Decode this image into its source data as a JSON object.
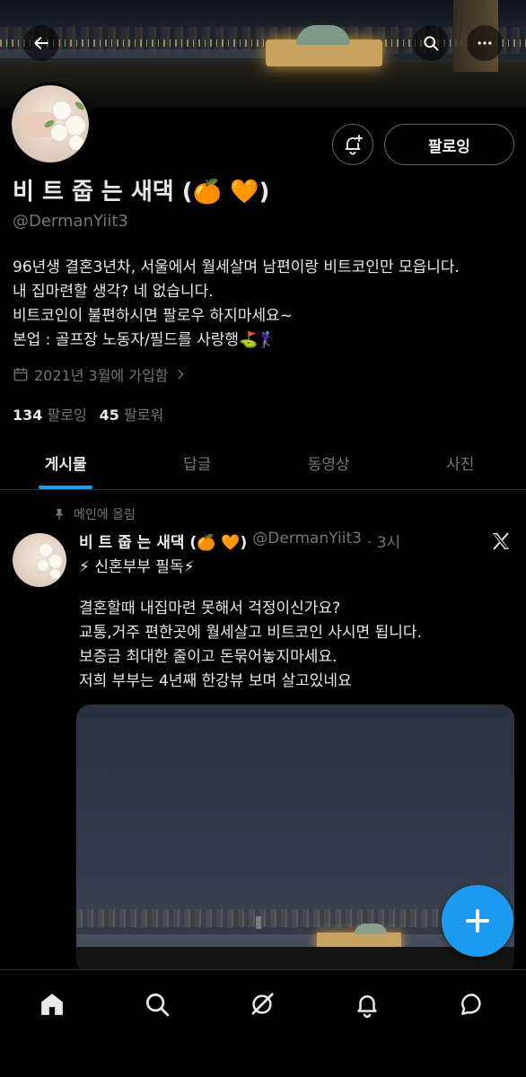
{
  "header": {
    "back_icon": "arrow-left-icon",
    "search_icon": "search-icon",
    "more_icon": "more-horizontal-icon"
  },
  "profile": {
    "display_name": "비 트 줍 는 새댁 (🍊 🧡)",
    "handle": "@DermanYiit3",
    "follow_label": "팔로잉",
    "notify_icon": "bell-plus-icon",
    "bio": [
      "96년생 결혼3년차, 서울에서 월세살며 남편이랑 비트코인만 모읍니다.",
      "내 집마련할 생각? 네 없습니다.",
      "비트코인이 불편하시면 팔로우 하지마세요~",
      "본업 : 골프장 노동자/필드를 사랑행⛳️🏌️‍♀️"
    ],
    "joined": "2021년 3월에 가입함",
    "following_count": "134",
    "following_label": "팔로잉",
    "followers_count": "45",
    "followers_label": "팔로워"
  },
  "tabs": [
    {
      "label": "게시물",
      "active": true
    },
    {
      "label": "답글",
      "active": false
    },
    {
      "label": "동영상",
      "active": false
    },
    {
      "label": "사진",
      "active": false
    }
  ],
  "post": {
    "pinned_label": "메인에 올림",
    "author_name": "비 트 줍 는 새댁 (🍊 🧡)",
    "author_handle": "@DermanYiit3",
    "time": "· 3시",
    "tagline": "⚡ 신혼부부 필독⚡",
    "body": [
      "결혼할때 내집마련 못해서 걱정이신가요?",
      "교통,거주 편한곳에 월세살고 비트코인 사시면 됩니다.",
      "보증금 최대한 줄이고 돈묶어놓지마세요.",
      "저희 부부는 4년째 한강뷰 보며 살고있네요"
    ]
  },
  "fab": {
    "icon": "plus-icon"
  },
  "bottom_nav": [
    {
      "icon": "home-icon",
      "active": true
    },
    {
      "icon": "search-icon",
      "active": false
    },
    {
      "icon": "grok-icon",
      "active": false
    },
    {
      "icon": "bell-icon",
      "active": false
    },
    {
      "icon": "message-icon",
      "active": false
    }
  ],
  "colors": {
    "accent": "#1d9bf0",
    "background": "#000000",
    "text": "#e7e9ea",
    "muted": "#71767b"
  }
}
